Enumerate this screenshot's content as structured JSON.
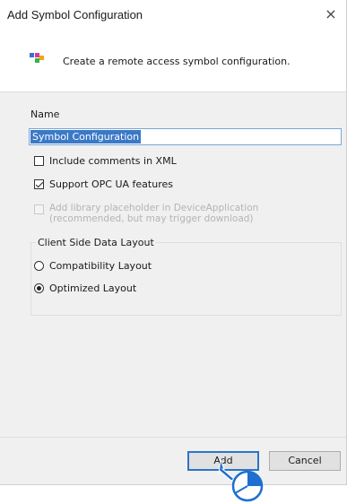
{
  "window": {
    "title": "Add Symbol Configuration",
    "close_glyph": "×"
  },
  "header": {
    "icon": "symbol-config-icon",
    "text": "Create a remote access symbol configuration."
  },
  "name_field": {
    "label": "Name",
    "value": "Symbol Configuration"
  },
  "options": {
    "include_comments": {
      "label": "Include comments in XML",
      "checked": false
    },
    "support_opc_ua": {
      "label": "Support OPC UA features",
      "checked": true
    },
    "library_placeholder": {
      "label_line1": "Add library placeholder in DeviceApplication",
      "label_line2": "(recommended, but may trigger download)",
      "checked": false,
      "enabled": false
    }
  },
  "client_layout": {
    "title": "Client Side Data Layout",
    "options": [
      {
        "label": "Compatibility Layout",
        "selected": false
      },
      {
        "label": "Optimized Layout",
        "selected": true
      }
    ]
  },
  "buttons": {
    "add": "Add",
    "cancel": "Cancel"
  },
  "colors": {
    "accent": "#3b79c7",
    "cursor": "#1e6fd0"
  }
}
